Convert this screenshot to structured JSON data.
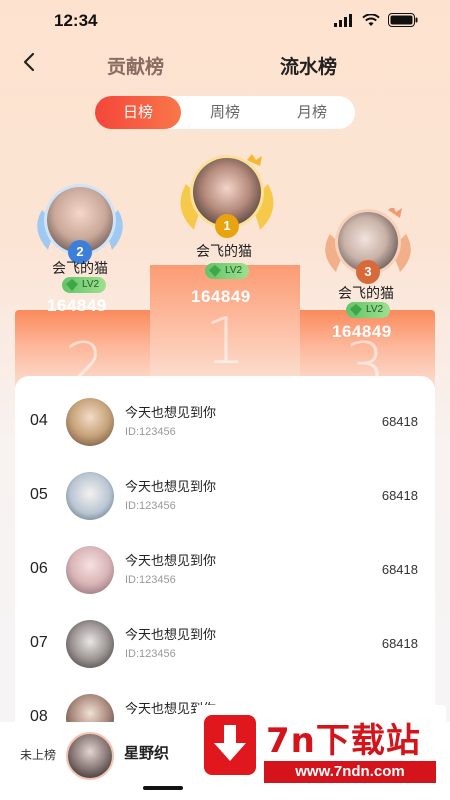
{
  "status": {
    "time": "12:34"
  },
  "header": {
    "tab_contribution": "贡献榜",
    "tab_flow": "流水榜"
  },
  "segment": {
    "items": [
      "日榜",
      "周榜",
      "月榜"
    ],
    "active": "日榜"
  },
  "podium": {
    "first": {
      "rank": "1",
      "name": "会飞的猫",
      "level": "LV2",
      "score": "164849",
      "block_number": "1"
    },
    "second": {
      "rank": "2",
      "name": "会飞的猫",
      "level": "LV2",
      "score": "164849",
      "block_number": "2"
    },
    "third": {
      "rank": "3",
      "name": "会飞的猫",
      "level": "LV2",
      "score": "164849",
      "block_number": "3"
    }
  },
  "list": [
    {
      "rank": "04",
      "name": "今天也想见到你",
      "id": "ID:123456",
      "score": "68418"
    },
    {
      "rank": "05",
      "name": "今天也想见到你",
      "id": "ID:123456",
      "score": "68418"
    },
    {
      "rank": "06",
      "name": "今天也想见到你",
      "id": "ID:123456",
      "score": "68418"
    },
    {
      "rank": "07",
      "name": "今天也想见到你",
      "id": "ID:123456",
      "score": "68418"
    },
    {
      "rank": "08",
      "name": "今天也想见到你",
      "id": "ID:123456",
      "score": ""
    }
  ],
  "me": {
    "status": "未上榜",
    "name": "星野织"
  },
  "watermark": {
    "title": "7n下载站",
    "url": "www.7ndn.com"
  },
  "colors": {
    "accent": "#f4463a",
    "podium": "#fb8a5c",
    "level_badge": "#62c46a",
    "watermark": "#d4141a"
  }
}
